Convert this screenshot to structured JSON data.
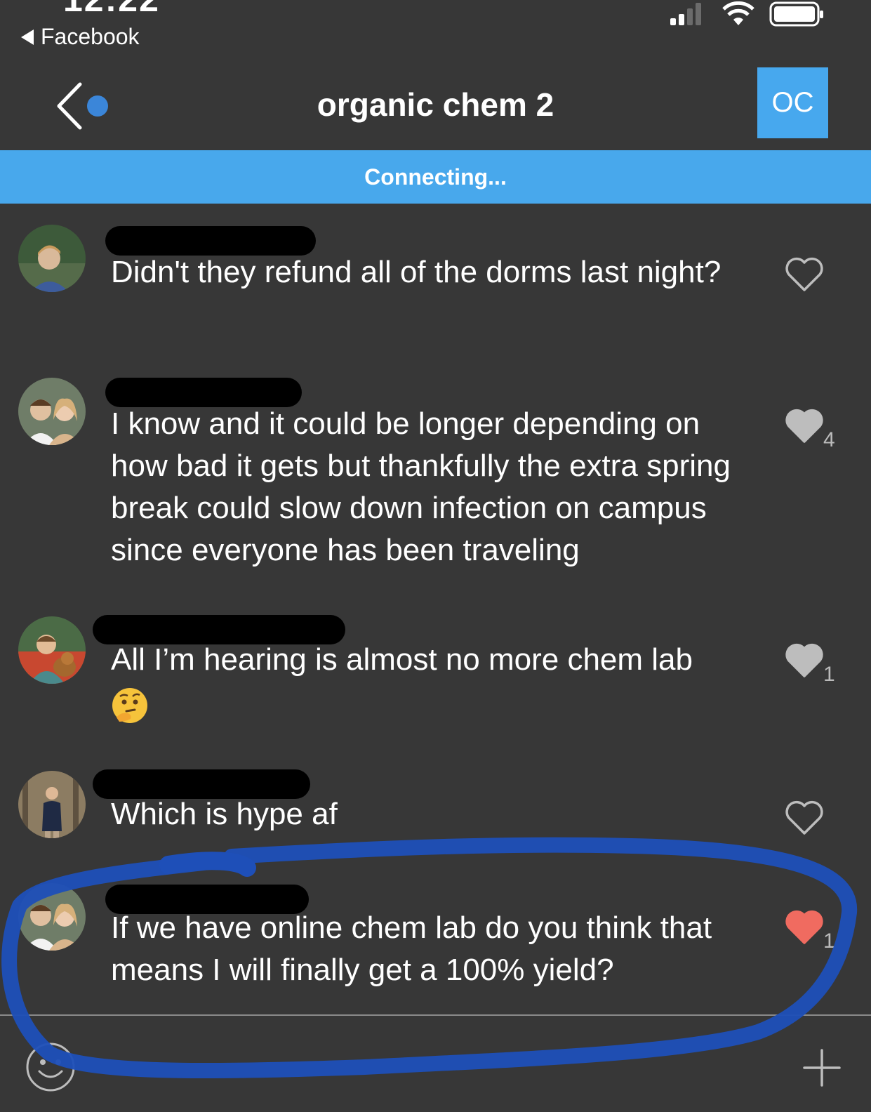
{
  "status": {
    "time": "12:22",
    "back_app": "Facebook"
  },
  "header": {
    "title": "organic chem 2",
    "avatar_initials": "OC"
  },
  "banner": {
    "text": "Connecting..."
  },
  "messages": [
    {
      "text": "Didn't they refund all of the dorms last night?",
      "likes": "",
      "liked": false
    },
    {
      "text": "I know and it could be longer depending on how bad it gets but thankfully the extra spring break could slow down infection on campus since everyone has been traveling",
      "likes": "4",
      "liked": false
    },
    {
      "text": "All I’m hearing is almost no more chem lab",
      "likes": "1",
      "liked": false
    },
    {
      "text": "Which is hype af",
      "likes": "",
      "liked": false
    },
    {
      "text": "If we have online chem lab do you think that means I will finally get a 100% yield?",
      "likes": "1",
      "liked": true
    }
  ],
  "colors": {
    "background": "#373737",
    "accent": "#47a8ee",
    "liked_heart": "#f06b60",
    "annotation": "#1e4fb8"
  },
  "icons": {
    "reaction": "heart-icon",
    "emoji": "smiley-icon",
    "attach": "plus-icon"
  }
}
